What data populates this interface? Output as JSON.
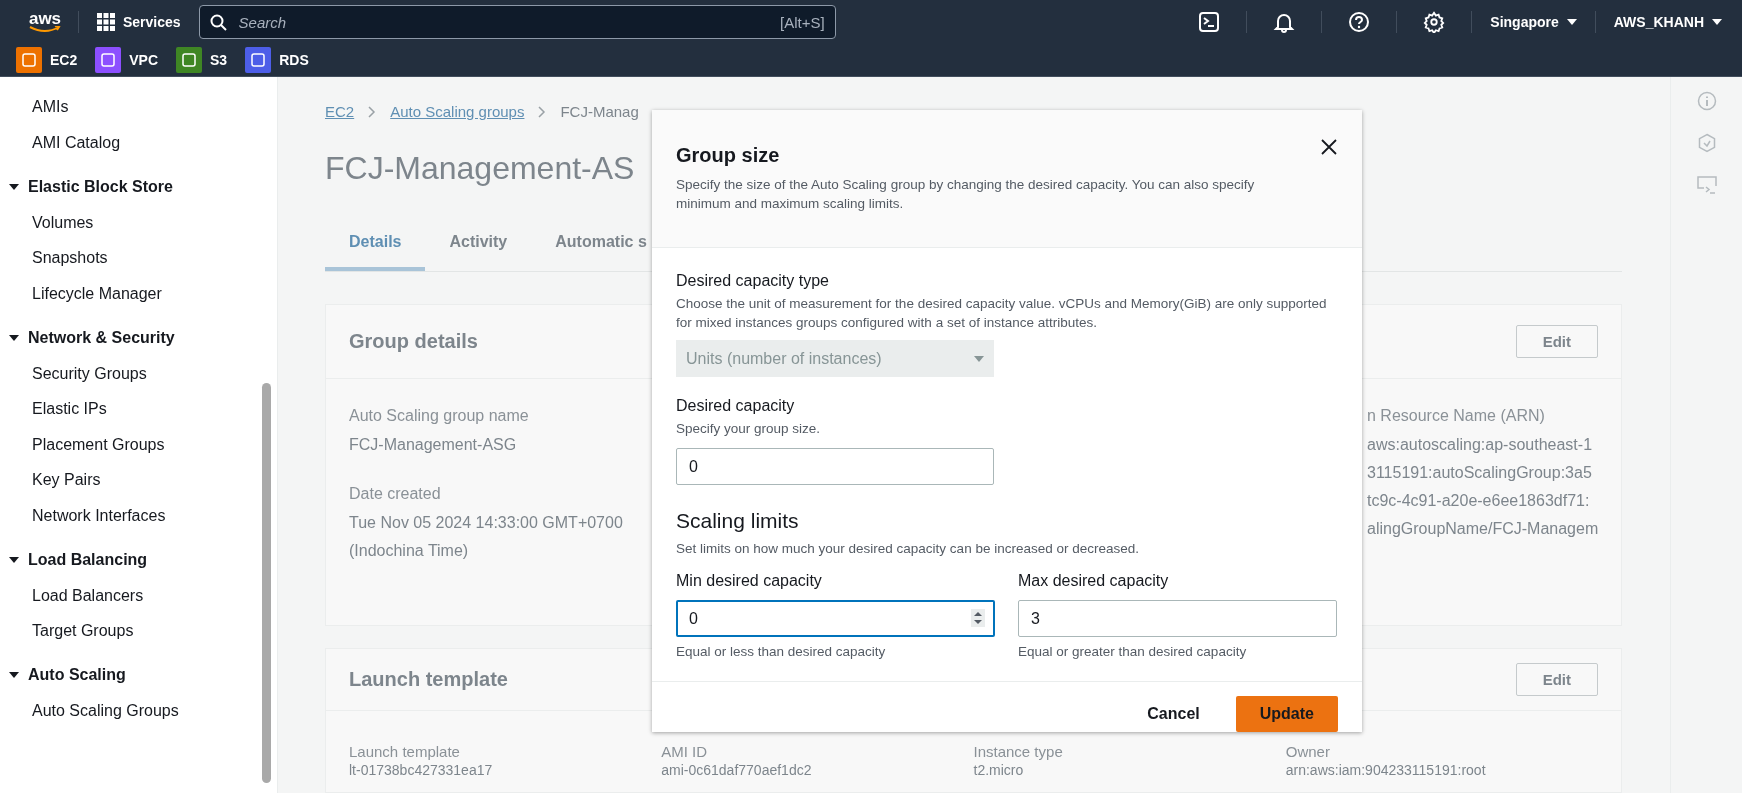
{
  "topbar": {
    "logo": "aws",
    "services": "Services",
    "search": {
      "placeholder": "Search",
      "shortcut": "[Alt+S]"
    },
    "region": "Singapore",
    "account": "AWS_KHANH"
  },
  "favorites": [
    {
      "label": "EC2",
      "color": "#ed7100"
    },
    {
      "label": "VPC",
      "color": "#8c4fff"
    },
    {
      "label": "S3",
      "color": "#3f8624"
    },
    {
      "label": "RDS",
      "color": "#4d5ee8"
    }
  ],
  "sidebar": {
    "items": [
      {
        "label": "AMIs"
      },
      {
        "label": "AMI Catalog"
      },
      {
        "label": "Elastic Block Store",
        "expanded": true,
        "children": [
          {
            "label": "Volumes"
          },
          {
            "label": "Snapshots"
          },
          {
            "label": "Lifecycle Manager"
          }
        ]
      },
      {
        "label": "Network & Security",
        "expanded": true,
        "children": [
          {
            "label": "Security Groups"
          },
          {
            "label": "Elastic IPs"
          },
          {
            "label": "Placement Groups"
          },
          {
            "label": "Key Pairs"
          },
          {
            "label": "Network Interfaces"
          }
        ]
      },
      {
        "label": "Load Balancing",
        "expanded": true,
        "children": [
          {
            "label": "Load Balancers"
          },
          {
            "label": "Target Groups"
          }
        ]
      },
      {
        "label": "Auto Scaling",
        "expanded": true,
        "children": [
          {
            "label": "Auto Scaling Groups"
          }
        ]
      }
    ]
  },
  "page": {
    "breadcrumbs": [
      "EC2",
      "Auto Scaling groups",
      "FCJ-Manag"
    ],
    "title": "FCJ-Management-AS",
    "tabs": [
      {
        "label": "Details",
        "selected": true
      },
      {
        "label": "Activity",
        "selected": false
      },
      {
        "label": "Automatic s",
        "selected": false
      }
    ],
    "group_details": {
      "title": "Group details",
      "edit": "Edit",
      "fields": [
        {
          "label": "Auto Scaling group name",
          "value": "FCJ-Management-ASG"
        },
        {
          "label": "Date created",
          "value": "Tue Nov 05 2024 14:33:00 GMT+0700 (Indochina Time)"
        }
      ],
      "arn": {
        "label": "n Resource Name (ARN)",
        "lines": [
          "aws:autoscaling:ap-southeast-1",
          "3115191:autoScalingGroup:3a5",
          "tc9c-4c91-a20e-e6ee1863df71:",
          "alingGroupName/FCJ-Managem"
        ]
      }
    },
    "launch_template": {
      "title": "Launch template",
      "edit": "Edit",
      "fields": [
        {
          "label": "Launch template",
          "value": "lt-01738bc427331ea17"
        },
        {
          "label": "AMI ID",
          "value": "ami-0c61daf770aef1dc2"
        },
        {
          "label": "Instance type",
          "value": "t2.micro"
        },
        {
          "label": "Owner",
          "value": "arn:aws:iam:904233115191:root"
        }
      ]
    }
  },
  "modal": {
    "title": "Group size",
    "description": "Specify the size of the Auto Scaling group by changing the desired capacity. You can also specify minimum and maximum scaling limits.",
    "capacity_type": {
      "label": "Desired capacity type",
      "description": "Choose the unit of measurement for the desired capacity value. vCPUs and Memory(GiB) are only supported for mixed instances groups configured with a set of instance attributes.",
      "value": "Units (number of instances)",
      "disabled": true
    },
    "desired": {
      "label": "Desired capacity",
      "description": "Specify your group size.",
      "value": "0"
    },
    "limits": {
      "title": "Scaling limits",
      "description": "Set limits on how much your desired capacity can be increased or decreased.",
      "fields": [
        {
          "label": "Min desired capacity",
          "value": "0",
          "hint": "Equal or less than desired capacity",
          "focused": true
        },
        {
          "label": "Max desired capacity",
          "value": "3",
          "hint": "Equal or greater than desired capacity",
          "focused": false
        }
      ]
    },
    "cancel": "Cancel",
    "submit": "Update"
  }
}
